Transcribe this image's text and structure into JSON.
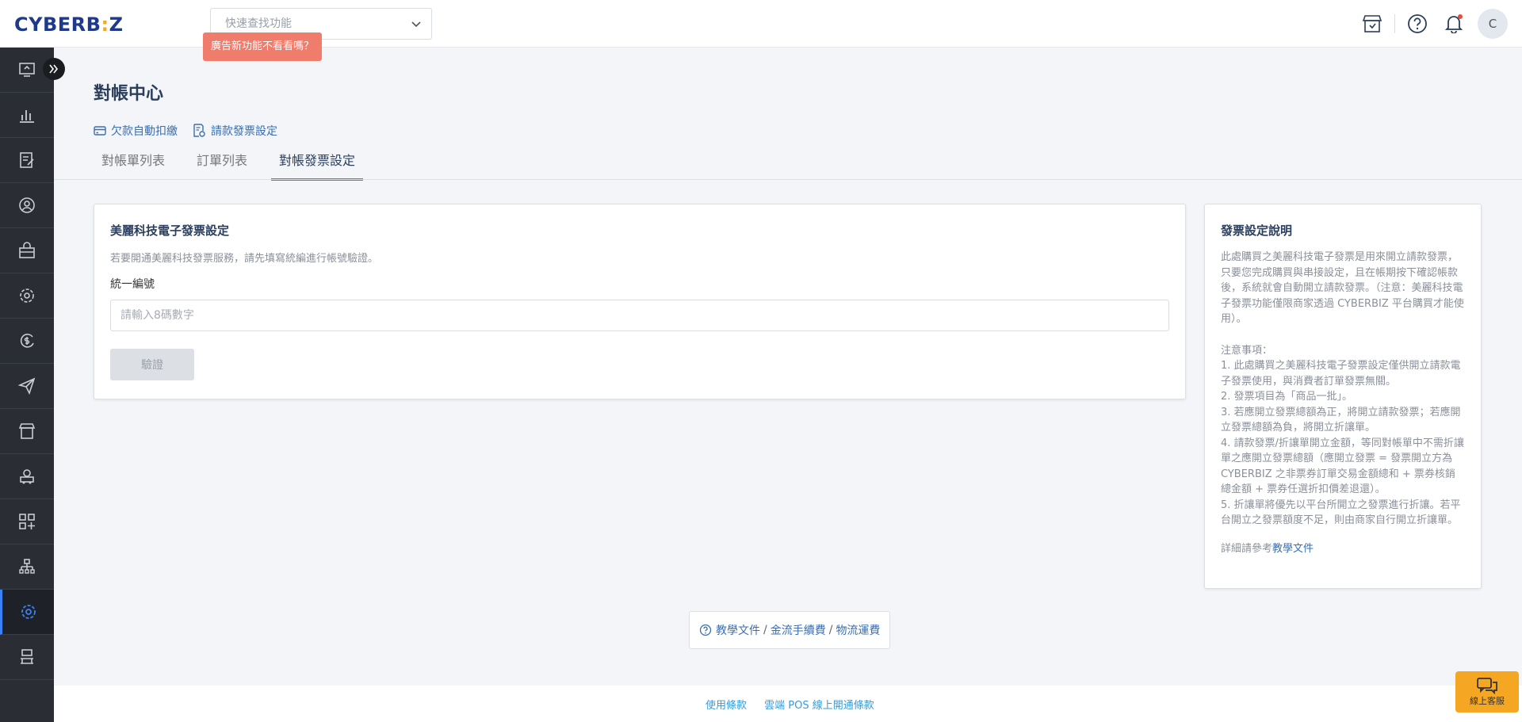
{
  "header": {
    "logo_text": "CYBERB",
    "logo_dot": ":",
    "logo_end": "Z",
    "search_placeholder": "快速查找功能",
    "ad_tooltip": "廣告新功能不看看嗎？",
    "avatar_initial": "C"
  },
  "sidebar": {
    "items": [
      {
        "icon": "dashboard-icon"
      },
      {
        "icon": "chart-icon"
      },
      {
        "icon": "orders-icon"
      },
      {
        "icon": "customer-icon"
      },
      {
        "icon": "products-icon"
      },
      {
        "icon": "settings-gear-icon"
      },
      {
        "icon": "finance-icon"
      },
      {
        "icon": "marketing-send-icon"
      },
      {
        "icon": "store-icon"
      },
      {
        "icon": "delivery-icon"
      },
      {
        "icon": "apps-icon"
      },
      {
        "icon": "org-icon"
      },
      {
        "icon": "settings-icon",
        "active": true
      },
      {
        "icon": "pos-icon"
      }
    ]
  },
  "page": {
    "title": "對帳中心",
    "sublinks": [
      {
        "label": "欠款自動扣繳",
        "icon": "credit-card-icon"
      },
      {
        "label": "請款發票設定",
        "icon": "invoice-settings-icon"
      }
    ],
    "tabs": [
      {
        "label": "對帳單列表",
        "active": false
      },
      {
        "label": "訂單列表",
        "active": false
      },
      {
        "label": "對帳發票設定",
        "active": true
      }
    ]
  },
  "invoice_card": {
    "title": "美麗科技電子發票設定",
    "description": "若要開通美麗科技發票服務，請先填寫統編進行帳號驗證。",
    "field_label": "統一編號",
    "field_value": "",
    "field_placeholder": "請輸入8碼數字",
    "verify_button": "驗證"
  },
  "help_card": {
    "title": "發票設定說明",
    "paragraph": "此處購買之美麗科技電子發票是用來開立請款發票，只要您完成購買與串接設定，且在帳期按下確認帳款後，系統就會自動開立請款發票。（注意：美麗科技電子發票功能僅限商家透過 CYBERBIZ 平台購買才能使用）。",
    "notes_title": "注意事項：",
    "notes": [
      "1. 此處購買之美麗科技電子發票設定僅供開立請款電子發票使用，與消費者訂單發票無關。",
      "2. 發票項目為「商品一批」。",
      "3. 若應開立發票總額為正，將開立請款發票；若應開立發票總額為負，將開立折讓單。",
      "4. 請款發票/折讓單開立金額，等同對帳單中不需折讓單之應開立發票總額（應開立發票 = 發票開立方為 CYBERBIZ 之非票券訂單交易金額總和 + 票券核銷總金額 + 票券任選折扣價差退還）。",
      "5. 折讓單將優先以平台所開立之發票進行折讓。若平台開立之發票額度不足，則由商家自行開立折讓單。"
    ],
    "footer_prefix": "詳細請參考",
    "footer_link": "教學文件"
  },
  "doc_links": {
    "items": [
      "教學文件",
      "金流手續費",
      "物流運費"
    ],
    "separator": "/"
  },
  "footer": {
    "links": [
      "使用條款",
      "雲端 POS 線上開通條款"
    ]
  },
  "chat": {
    "label": "線上客服"
  },
  "colors": {
    "accent": "#3b82f6",
    "sidebar": "#2a2d33",
    "tooltip": "#f07c6c",
    "chat": "#f5a623"
  }
}
